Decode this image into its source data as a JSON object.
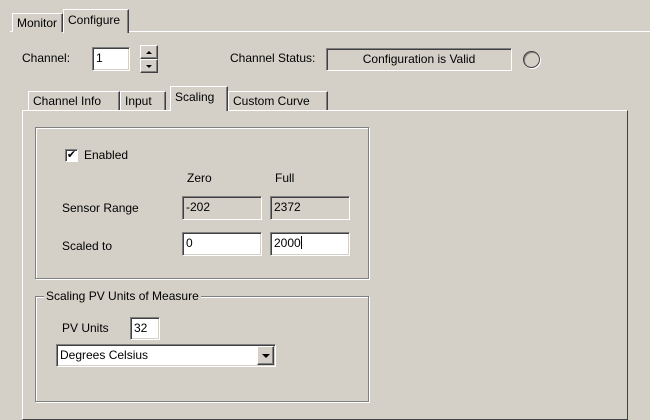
{
  "top_tabs": [
    {
      "label": "Monitor",
      "selected": false
    },
    {
      "label": "Configure",
      "selected": true
    }
  ],
  "channel": {
    "label": "Channel:",
    "value": "1",
    "status_label": "Channel Status:",
    "status_value": "Configuration is Valid"
  },
  "sub_tabs": [
    {
      "label": "Channel Info",
      "selected": false
    },
    {
      "label": "Input",
      "selected": false
    },
    {
      "label": "Scaling",
      "selected": true
    },
    {
      "label": "Custom Curve",
      "selected": false
    }
  ],
  "scaling": {
    "enabled_label": "Enabled",
    "enabled_checked": true,
    "checkmark": "✔",
    "col_zero": "Zero",
    "col_full": "Full",
    "sensor_range_label": "Sensor Range",
    "sensor_zero": "-202",
    "sensor_full": "2372",
    "scaled_to_label": "Scaled to",
    "scaled_zero": "0",
    "scaled_full": "2000"
  },
  "units_group": {
    "legend": "Scaling PV Units of Measure",
    "pv_units_label": "PV Units",
    "pv_units_value": "32",
    "units_selected": "Degrees Celsius"
  }
}
